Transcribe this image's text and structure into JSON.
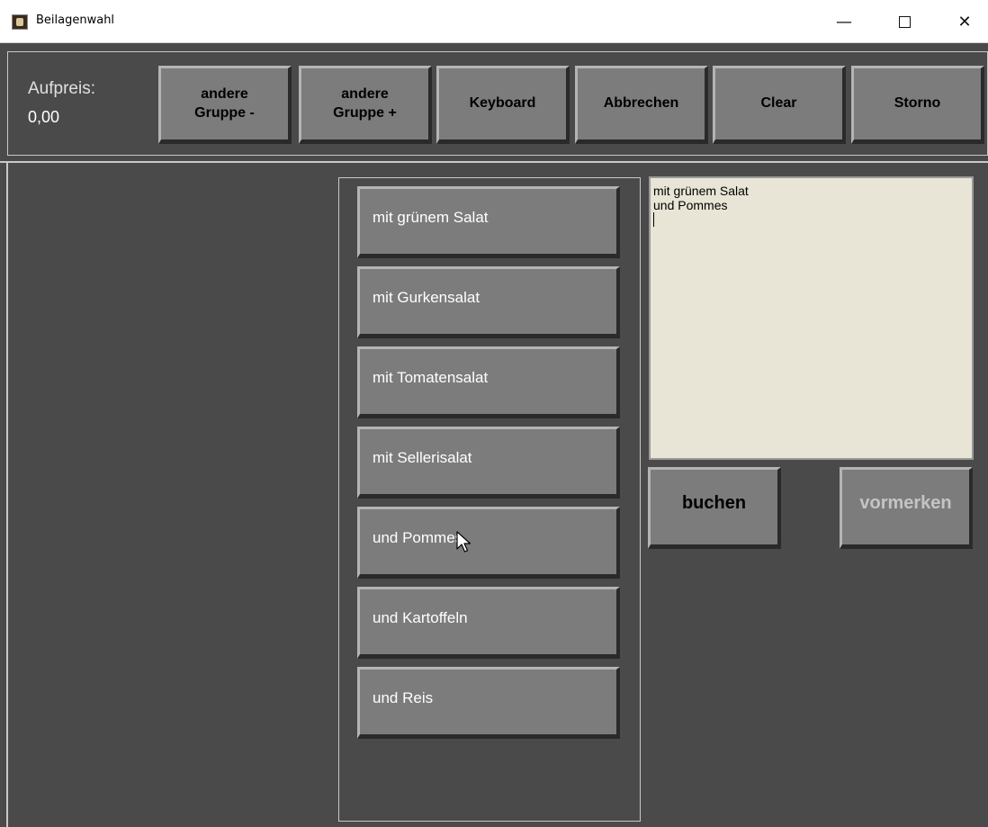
{
  "window": {
    "title": "Beilagenwahl",
    "controls": {
      "minimize": "—",
      "close": "✕"
    }
  },
  "toolbar": {
    "aufpreis_label": "Aufpreis:",
    "aufpreis_value": "0,00",
    "buttons": [
      {
        "line1": "andere",
        "line2": "Gruppe -"
      },
      {
        "line1": "andere",
        "line2": "Gruppe +"
      },
      {
        "label": "Keyboard"
      },
      {
        "label": "Abbrechen"
      },
      {
        "label": "Clear"
      },
      {
        "label": "Storno"
      }
    ]
  },
  "items": [
    "mit grünem Salat",
    "mit Gurkensalat",
    "mit Tomatensalat",
    "mit Sellerisalat",
    "und Pommes",
    "und Kartoffeln",
    "und Reis"
  ],
  "memo": {
    "lines": [
      "mit grünem Salat",
      "und Pommes"
    ]
  },
  "actions": {
    "buchen": "buchen",
    "vormerken": "vormerken"
  },
  "colors": {
    "background": "#4a4a4a",
    "button_face": "#7c7c7c",
    "memo_background": "#e8e5d6",
    "disabled_text": "#c4c4c4"
  }
}
